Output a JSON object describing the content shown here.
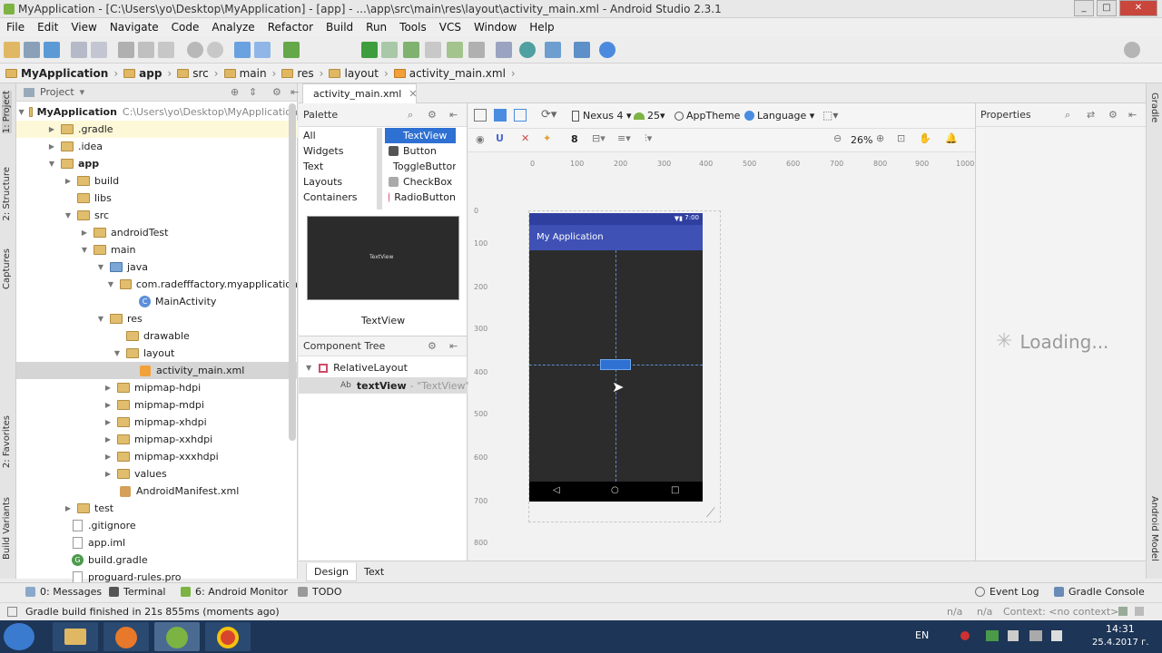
{
  "window": {
    "title": "MyApplication - [C:\\Users\\yo\\Desktop\\MyApplication] - [app] - ...\\app\\src\\main\\res\\layout\\activity_main.xml - Android Studio 2.3.1"
  },
  "menu": [
    "File",
    "Edit",
    "View",
    "Navigate",
    "Code",
    "Analyze",
    "Refactor",
    "Build",
    "Run",
    "Tools",
    "VCS",
    "Window",
    "Help"
  ],
  "toolbar": {
    "run_config": "app"
  },
  "breadcrumb": [
    "MyApplication",
    "app",
    "src",
    "main",
    "res",
    "layout",
    "activity_main.xml"
  ],
  "left_strip": {
    "project": "1: Project",
    "structure": "2: Structure",
    "captures": "Captures",
    "favorites": "2: Favorites",
    "build_variants": "Build Variants"
  },
  "right_strip": {
    "gradle": "Gradle",
    "android_model": "Android Model"
  },
  "project": {
    "header": "Project",
    "root": {
      "name": "MyApplication",
      "path": "C:\\Users\\yo\\Desktop\\MyApplication"
    },
    "items": [
      ".gradle",
      ".idea",
      "app",
      "build",
      "libs",
      "src",
      "androidTest",
      "main",
      "java",
      "com.radefffactory.myapplication",
      "MainActivity",
      "res",
      "drawable",
      "layout",
      "activity_main.xml",
      "mipmap-hdpi",
      "mipmap-mdpi",
      "mipmap-xhdpi",
      "mipmap-xxhdpi",
      "mipmap-xxxhdpi",
      "values",
      "AndroidManifest.xml",
      "test",
      ".gitignore",
      "app.iml",
      "build.gradle",
      "proguard-rules.pro"
    ]
  },
  "editor": {
    "tab": "activity_main.xml"
  },
  "palette": {
    "header": "Palette",
    "categories": [
      "All",
      "Widgets",
      "Text",
      "Layouts",
      "Containers"
    ],
    "items": [
      "TextView",
      "Button",
      "ToggleButton",
      "CheckBox",
      "RadioButton"
    ],
    "preview_text": "TextView",
    "preview_label": "TextView"
  },
  "component_tree": {
    "header": "Component Tree",
    "root": "RelativeLayout",
    "child_name": "textView",
    "child_text": "- \"TextView\"",
    "child_prefix": "Ab"
  },
  "canvas": {
    "device": "Nexus 4",
    "api": "25",
    "theme": "AppTheme",
    "language": "Language",
    "zoom": "26%",
    "margin_value": "8",
    "ruler_h": [
      "0",
      "100",
      "200",
      "300",
      "400",
      "500",
      "600",
      "700",
      "800",
      "900",
      "1000"
    ],
    "ruler_v": [
      "0",
      "100",
      "200",
      "300",
      "400",
      "500",
      "600",
      "700",
      "800"
    ],
    "app_title": "My Application",
    "clock": "7:00"
  },
  "properties": {
    "header": "Properties",
    "loading": "Loading..."
  },
  "design_tabs": [
    "Design",
    "Text"
  ],
  "bottom_tools": {
    "messages": "0: Messages",
    "terminal": "Terminal",
    "monitor": "6: Android Monitor",
    "todo": "TODO",
    "event_log": "Event Log",
    "gradle_console": "Gradle Console"
  },
  "status": {
    "message": "Gradle build finished in 21s 855ms (moments ago)",
    "na1": "n/a",
    "na2": "n/a",
    "context": "Context: <no context>"
  },
  "taskbar": {
    "lang": "EN",
    "time": "14:31",
    "date": "25.4.2017 г."
  }
}
